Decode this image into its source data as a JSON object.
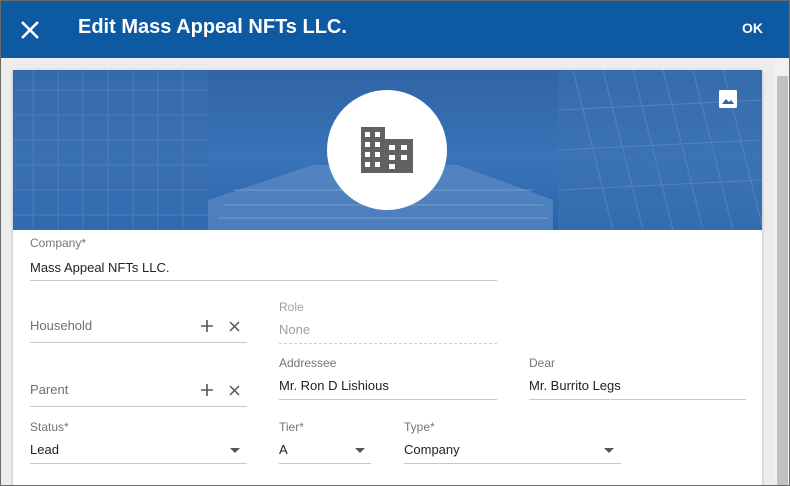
{
  "header": {
    "title": "Edit Mass Appeal NFTs LLC.",
    "ok_label": "OK",
    "close_icon": "close-icon",
    "background": "#0d5aa2"
  },
  "banner": {
    "avatar_icon": "building-icon",
    "change_image_icon": "image-icon"
  },
  "form": {
    "company": {
      "label": "Company*",
      "value": "Mass Appeal NFTs LLC."
    },
    "household": {
      "label": "Household",
      "value": ""
    },
    "role": {
      "label": "Role",
      "value": "None"
    },
    "parent": {
      "label": "Parent",
      "value": ""
    },
    "addressee": {
      "label": "Addressee",
      "value": "Mr. Ron D Lishious"
    },
    "dear": {
      "label": "Dear",
      "value": "Mr. Burrito Legs"
    },
    "status": {
      "label": "Status*",
      "value": "Lead"
    },
    "tier": {
      "label": "Tier*",
      "value": "A"
    },
    "type": {
      "label": "Type*",
      "value": "Company"
    }
  }
}
